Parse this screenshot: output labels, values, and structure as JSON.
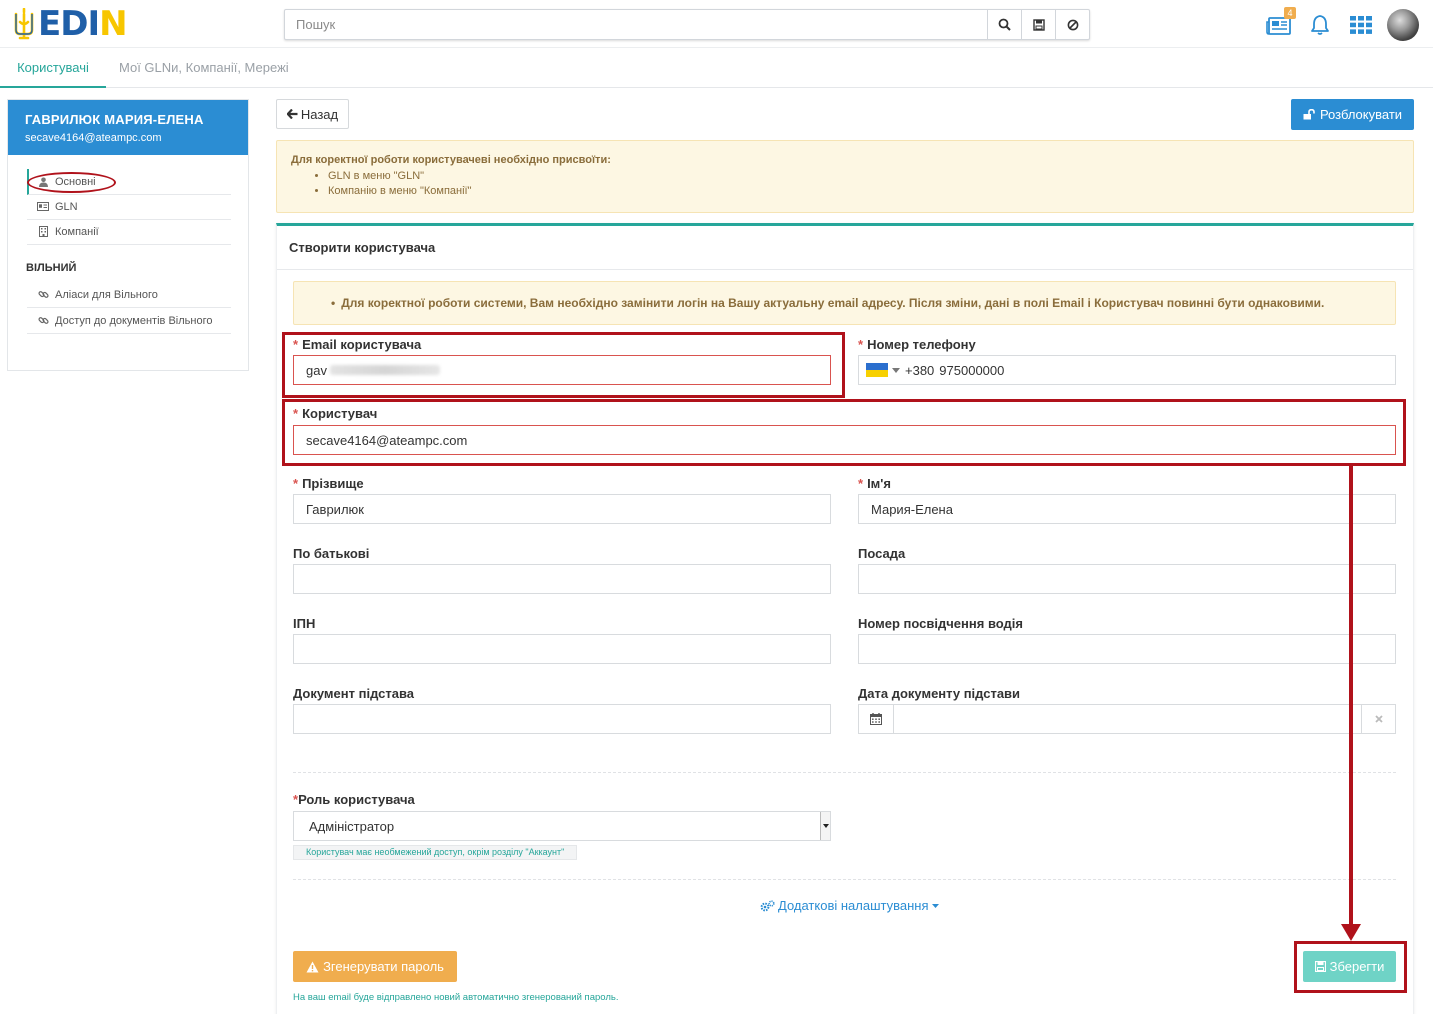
{
  "header": {
    "logo_text": "EDIN",
    "search_placeholder": "Пошук",
    "notifications_badge": "4"
  },
  "tabs": {
    "users": "Користувачі",
    "glns": "Мої GLNи, Компанії, Мережі"
  },
  "sidebar": {
    "user_name": "ГАВРИЛЮК МАРИЯ-ЕЛЕНА",
    "user_email": "secave4164@ateampc.com",
    "items": [
      {
        "label": "Основні"
      },
      {
        "label": "GLN"
      },
      {
        "label": "Компанії"
      }
    ],
    "section_title": "ВІЛЬНИЙ",
    "section_items": [
      {
        "label": "Аліаси для Вільного"
      },
      {
        "label": "Доступ до документів Вільного"
      }
    ]
  },
  "toolbar": {
    "back_label": "Назад",
    "unlock_label": "Розблокувати"
  },
  "notice": {
    "title": "Для коректної роботи користувачеві необхідно присвоїти:",
    "items": [
      "GLN в меню \"GLN\"",
      "Компанію в меню \"Компанії\""
    ]
  },
  "form": {
    "title": "Створити користувача",
    "warning": "Для коректної роботи системи, Вам необхідно замінити логін на Вашу актуальну email адресу. Після зміни, дані в полі Email і Користувач повинні бути однаковими.",
    "email_label": "Email користувача",
    "email_value": "gav",
    "phone_label": "Номер телефону",
    "phone_code": "+380",
    "phone_value": "975000000",
    "user_label": "Користувач",
    "user_value": "secave4164@ateampc.com",
    "surname_label": "Прізвище",
    "surname_value": "Гаврилюк",
    "name_label": "Ім'я",
    "name_value": "Мария-Елена",
    "patronymic_label": "По батькові",
    "position_label": "Посада",
    "ipn_label": "ІПН",
    "driver_label": "Номер посвідчення водія",
    "doc_label": "Документ підстава",
    "doc_date_label": "Дата документу підстави",
    "role_label": "Роль користувача",
    "role_value": "Адміністратор",
    "role_help": "Користувач має необмежений доступ, окрім розділу \"Аккаунт\"",
    "advanced_label": "Додаткові налаштування",
    "generate_label": "Згенерувати пароль",
    "generate_note": "На ваш email буде відправлено новий автоматично згенерований пароль.",
    "save_label": "Зберегти"
  },
  "colors": {
    "accent": "#26a69a",
    "primary": "#2b8dd3",
    "warning": "#f0ad4e",
    "highlight": "#b0121b"
  }
}
